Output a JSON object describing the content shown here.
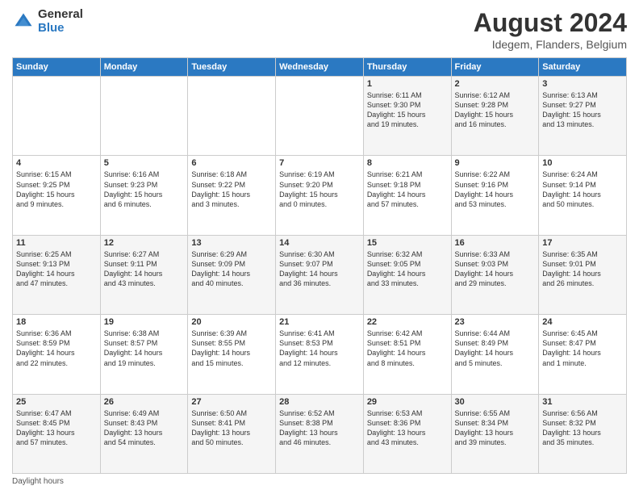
{
  "logo": {
    "general": "General",
    "blue": "Blue"
  },
  "title": "August 2024",
  "subtitle": "Idegem, Flanders, Belgium",
  "days_of_week": [
    "Sunday",
    "Monday",
    "Tuesday",
    "Wednesday",
    "Thursday",
    "Friday",
    "Saturday"
  ],
  "footer": "Daylight hours",
  "weeks": [
    [
      {
        "day": "",
        "info": ""
      },
      {
        "day": "",
        "info": ""
      },
      {
        "day": "",
        "info": ""
      },
      {
        "day": "",
        "info": ""
      },
      {
        "day": "1",
        "info": "Sunrise: 6:11 AM\nSunset: 9:30 PM\nDaylight: 15 hours\nand 19 minutes."
      },
      {
        "day": "2",
        "info": "Sunrise: 6:12 AM\nSunset: 9:28 PM\nDaylight: 15 hours\nand 16 minutes."
      },
      {
        "day": "3",
        "info": "Sunrise: 6:13 AM\nSunset: 9:27 PM\nDaylight: 15 hours\nand 13 minutes."
      }
    ],
    [
      {
        "day": "4",
        "info": "Sunrise: 6:15 AM\nSunset: 9:25 PM\nDaylight: 15 hours\nand 9 minutes."
      },
      {
        "day": "5",
        "info": "Sunrise: 6:16 AM\nSunset: 9:23 PM\nDaylight: 15 hours\nand 6 minutes."
      },
      {
        "day": "6",
        "info": "Sunrise: 6:18 AM\nSunset: 9:22 PM\nDaylight: 15 hours\nand 3 minutes."
      },
      {
        "day": "7",
        "info": "Sunrise: 6:19 AM\nSunset: 9:20 PM\nDaylight: 15 hours\nand 0 minutes."
      },
      {
        "day": "8",
        "info": "Sunrise: 6:21 AM\nSunset: 9:18 PM\nDaylight: 14 hours\nand 57 minutes."
      },
      {
        "day": "9",
        "info": "Sunrise: 6:22 AM\nSunset: 9:16 PM\nDaylight: 14 hours\nand 53 minutes."
      },
      {
        "day": "10",
        "info": "Sunrise: 6:24 AM\nSunset: 9:14 PM\nDaylight: 14 hours\nand 50 minutes."
      }
    ],
    [
      {
        "day": "11",
        "info": "Sunrise: 6:25 AM\nSunset: 9:13 PM\nDaylight: 14 hours\nand 47 minutes."
      },
      {
        "day": "12",
        "info": "Sunrise: 6:27 AM\nSunset: 9:11 PM\nDaylight: 14 hours\nand 43 minutes."
      },
      {
        "day": "13",
        "info": "Sunrise: 6:29 AM\nSunset: 9:09 PM\nDaylight: 14 hours\nand 40 minutes."
      },
      {
        "day": "14",
        "info": "Sunrise: 6:30 AM\nSunset: 9:07 PM\nDaylight: 14 hours\nand 36 minutes."
      },
      {
        "day": "15",
        "info": "Sunrise: 6:32 AM\nSunset: 9:05 PM\nDaylight: 14 hours\nand 33 minutes."
      },
      {
        "day": "16",
        "info": "Sunrise: 6:33 AM\nSunset: 9:03 PM\nDaylight: 14 hours\nand 29 minutes."
      },
      {
        "day": "17",
        "info": "Sunrise: 6:35 AM\nSunset: 9:01 PM\nDaylight: 14 hours\nand 26 minutes."
      }
    ],
    [
      {
        "day": "18",
        "info": "Sunrise: 6:36 AM\nSunset: 8:59 PM\nDaylight: 14 hours\nand 22 minutes."
      },
      {
        "day": "19",
        "info": "Sunrise: 6:38 AM\nSunset: 8:57 PM\nDaylight: 14 hours\nand 19 minutes."
      },
      {
        "day": "20",
        "info": "Sunrise: 6:39 AM\nSunset: 8:55 PM\nDaylight: 14 hours\nand 15 minutes."
      },
      {
        "day": "21",
        "info": "Sunrise: 6:41 AM\nSunset: 8:53 PM\nDaylight: 14 hours\nand 12 minutes."
      },
      {
        "day": "22",
        "info": "Sunrise: 6:42 AM\nSunset: 8:51 PM\nDaylight: 14 hours\nand 8 minutes."
      },
      {
        "day": "23",
        "info": "Sunrise: 6:44 AM\nSunset: 8:49 PM\nDaylight: 14 hours\nand 5 minutes."
      },
      {
        "day": "24",
        "info": "Sunrise: 6:45 AM\nSunset: 8:47 PM\nDaylight: 14 hours\nand 1 minute."
      }
    ],
    [
      {
        "day": "25",
        "info": "Sunrise: 6:47 AM\nSunset: 8:45 PM\nDaylight: 13 hours\nand 57 minutes."
      },
      {
        "day": "26",
        "info": "Sunrise: 6:49 AM\nSunset: 8:43 PM\nDaylight: 13 hours\nand 54 minutes."
      },
      {
        "day": "27",
        "info": "Sunrise: 6:50 AM\nSunset: 8:41 PM\nDaylight: 13 hours\nand 50 minutes."
      },
      {
        "day": "28",
        "info": "Sunrise: 6:52 AM\nSunset: 8:38 PM\nDaylight: 13 hours\nand 46 minutes."
      },
      {
        "day": "29",
        "info": "Sunrise: 6:53 AM\nSunset: 8:36 PM\nDaylight: 13 hours\nand 43 minutes."
      },
      {
        "day": "30",
        "info": "Sunrise: 6:55 AM\nSunset: 8:34 PM\nDaylight: 13 hours\nand 39 minutes."
      },
      {
        "day": "31",
        "info": "Sunrise: 6:56 AM\nSunset: 8:32 PM\nDaylight: 13 hours\nand 35 minutes."
      }
    ]
  ]
}
